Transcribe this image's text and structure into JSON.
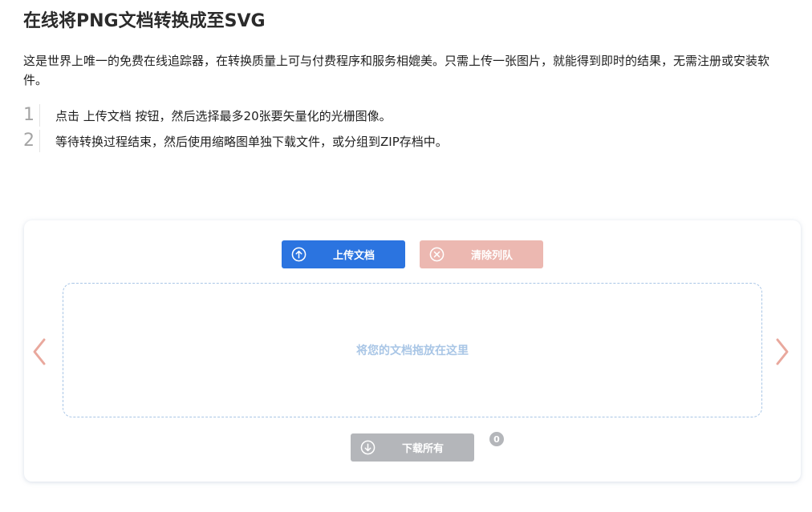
{
  "page": {
    "title": "在线将PNG文档转换成至SVG",
    "intro": "这是世界上唯一的免费在线追踪器，在转换质量上可与付费程序和服务相媲美。只需上传一张图片，就能得到即时的结果，无需注册或安装软件。"
  },
  "steps": [
    {
      "num": "1",
      "text": "点击 上传文档 按钮，然后选择最多20张要矢量化的光栅图像。"
    },
    {
      "num": "2",
      "text": "等待转换过程结束，然后使用缩略图单独下载文件，或分组到ZIP存档中。"
    }
  ],
  "converter": {
    "upload_label": "上传文档",
    "upload_icon": "arrow-up-circle-icon",
    "clear_label": "清除列队",
    "clear_icon": "x-circle-icon",
    "dropzone_text": "将您的文档拖放在这里",
    "download_label": "下载所有",
    "download_icon": "arrow-down-circle-icon",
    "download_count": "0",
    "prev_icon": "chevron-left-icon",
    "next_icon": "chevron-right-icon"
  },
  "colors": {
    "upload": "#2b74e0",
    "clear": "#ecb8b1",
    "download": "#b4b6ba",
    "dropzone": "#a9c6e6",
    "arrows": "#e9a89d"
  }
}
